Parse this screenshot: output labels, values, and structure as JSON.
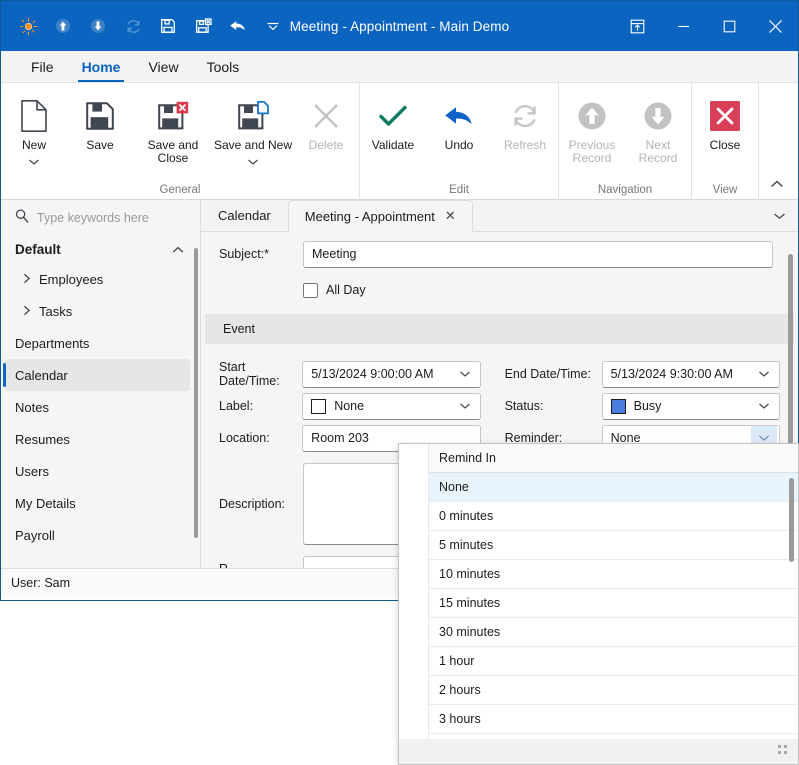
{
  "window": {
    "title": "Meeting - Appointment - Main Demo",
    "accent": "#0b64bf",
    "quick_access": [
      {
        "name": "app-logo-icon",
        "label": "Main Demo"
      },
      {
        "name": "previous-record-icon",
        "label": "Previous Record"
      },
      {
        "name": "next-record-icon",
        "label": "Next Record"
      },
      {
        "name": "refresh-icon",
        "label": "Refresh"
      },
      {
        "name": "save-icon",
        "label": "Save"
      },
      {
        "name": "save-and-close-icon",
        "label": "Save and Close"
      },
      {
        "name": "undo-icon",
        "label": "Undo"
      },
      {
        "name": "customize-quick-access-icon",
        "label": "Customize Quick Access Toolbar"
      }
    ],
    "controls": [
      {
        "name": "ribbon-display-options-button",
        "label": "Ribbon Display Options"
      },
      {
        "name": "minimize-button",
        "label": "Minimize"
      },
      {
        "name": "maximize-button",
        "label": "Maximize"
      },
      {
        "name": "close-button",
        "label": "Close"
      }
    ]
  },
  "ribbon": {
    "tabs": [
      {
        "label": "File",
        "active": false
      },
      {
        "label": "Home",
        "active": true
      },
      {
        "label": "View",
        "active": false
      },
      {
        "label": "Tools",
        "active": false
      }
    ],
    "groups": [
      {
        "label": "General",
        "items": [
          {
            "label": "New",
            "icon": "new-document-icon",
            "disabled": false,
            "dropdown": true
          },
          {
            "label": "Save",
            "icon": "save-icon",
            "disabled": false,
            "dropdown": false
          },
          {
            "label": "Save and Close",
            "icon": "save-and-close-icon",
            "disabled": false,
            "dropdown": false
          },
          {
            "label": "Save and New",
            "icon": "save-and-new-icon",
            "disabled": false,
            "dropdown": true
          },
          {
            "label": "Delete",
            "icon": "delete-icon",
            "disabled": true,
            "dropdown": false
          }
        ]
      },
      {
        "label": "Edit",
        "items": [
          {
            "label": "Validate",
            "icon": "validate-check-icon",
            "disabled": false,
            "dropdown": false
          },
          {
            "label": "Undo",
            "icon": "undo-icon",
            "disabled": false,
            "dropdown": false
          },
          {
            "label": "Refresh",
            "icon": "refresh-icon",
            "disabled": true,
            "dropdown": false
          }
        ]
      },
      {
        "label": "Navigation",
        "items": [
          {
            "label": "Previous Record",
            "icon": "previous-record-icon",
            "disabled": true,
            "dropdown": false
          },
          {
            "label": "Next Record",
            "icon": "next-record-icon",
            "disabled": true,
            "dropdown": false
          }
        ]
      },
      {
        "label": "View",
        "items": [
          {
            "label": "Close",
            "icon": "close-red-icon",
            "disabled": false,
            "dropdown": false
          }
        ]
      }
    ],
    "collapse_label": "Collapse the Ribbon"
  },
  "sidebar": {
    "search_placeholder": "Type keywords here",
    "group_label": "Default",
    "items": [
      {
        "label": "Employees",
        "expandable": true,
        "selected": false
      },
      {
        "label": "Tasks",
        "expandable": true,
        "selected": false
      },
      {
        "label": "Departments",
        "expandable": false,
        "selected": false
      },
      {
        "label": "Calendar",
        "expandable": false,
        "selected": true
      },
      {
        "label": "Notes",
        "expandable": false,
        "selected": false
      },
      {
        "label": "Resumes",
        "expandable": false,
        "selected": false
      },
      {
        "label": "Users",
        "expandable": false,
        "selected": false
      },
      {
        "label": "My Details",
        "expandable": false,
        "selected": false
      },
      {
        "label": "Payroll",
        "expandable": false,
        "selected": false
      }
    ]
  },
  "document_tabs": [
    {
      "label": "Calendar",
      "active": false,
      "closable": false
    },
    {
      "label": "Meeting - Appointment",
      "active": true,
      "closable": true,
      "close_glyph": "✕"
    }
  ],
  "form": {
    "subject": {
      "label": "Subject:*",
      "value": "Meeting"
    },
    "all_day": {
      "label": "All Day",
      "checked": false
    },
    "group_band": "Event",
    "start": {
      "label": "Start Date/Time:",
      "value": "5/13/2024 9:00:00 AM"
    },
    "end": {
      "label": "End Date/Time:",
      "value": "5/13/2024 9:30:00 AM"
    },
    "label_field": {
      "label": "Label:",
      "value": "None",
      "color": "#ffffff"
    },
    "status": {
      "label": "Status:",
      "value": "Busy",
      "color": "#4a7ede"
    },
    "location": {
      "label": "Location:",
      "value": "Room 203"
    },
    "reminder": {
      "label": "Reminder:",
      "value": "None",
      "active": true
    },
    "description": {
      "label": "Description:",
      "value": ""
    },
    "resources": {
      "label": "R",
      "value": ""
    }
  },
  "statusbar": {
    "user": "User: Sam"
  },
  "reminder_dropdown": {
    "header": "Remind In",
    "selected": "None",
    "marker_glyph": "▷",
    "options": [
      {
        "label": "None",
        "selected": true
      },
      {
        "label": "0 minutes",
        "selected": false
      },
      {
        "label": "5 minutes",
        "selected": false
      },
      {
        "label": "10 minutes",
        "selected": false
      },
      {
        "label": "15 minutes",
        "selected": false
      },
      {
        "label": "30 minutes",
        "selected": false
      },
      {
        "label": "1 hour",
        "selected": false
      },
      {
        "label": "2 hours",
        "selected": false
      },
      {
        "label": "3 hours",
        "selected": false
      }
    ],
    "partial_option": ""
  }
}
